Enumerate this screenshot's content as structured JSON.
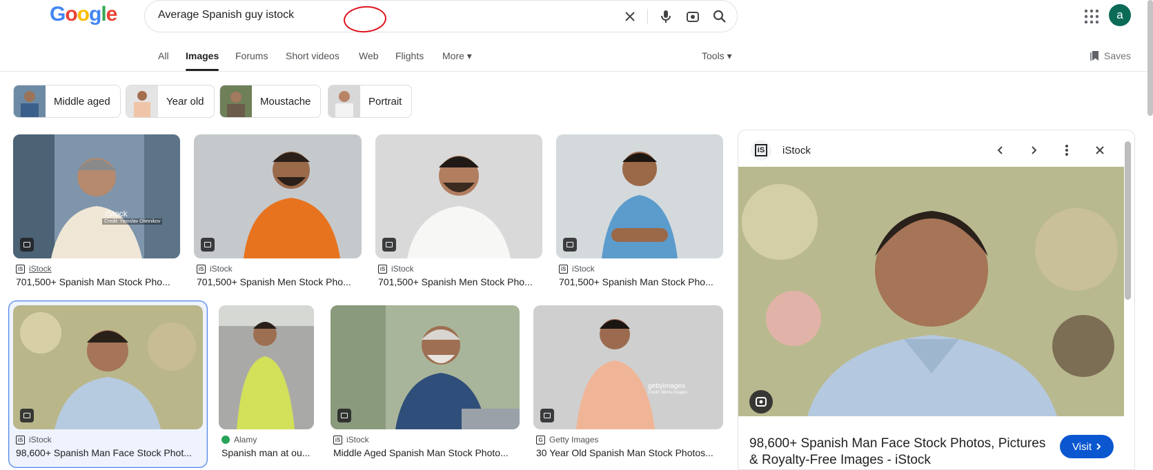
{
  "search": {
    "logo": "Google",
    "query": "Average Spanish guy istock"
  },
  "account": {
    "avatar_letter": "a"
  },
  "tabs": {
    "items": [
      "All",
      "Images",
      "Forums",
      "Short videos",
      "Web",
      "Flights",
      "More"
    ],
    "active": "Images",
    "tools_label": "Tools",
    "saves_label": "Saves"
  },
  "chips": [
    "Middle aged",
    "Year old",
    "Moustache",
    "Portrait"
  ],
  "results": [
    {
      "source": "iStock",
      "title": "701,500+ Spanish Man Stock Pho...",
      "watermark": "iStock",
      "credit": "Credit: Yaroslav Olieinikov"
    },
    {
      "source": "iStock",
      "title": "701,500+ Spanish Men Stock Pho..."
    },
    {
      "source": "iStock",
      "title": "701,500+ Spanish Men Stock Pho..."
    },
    {
      "source": "iStock",
      "title": "701,500+ Spanish Man Stock Pho..."
    },
    {
      "source": "iStock",
      "title": "98,600+ Spanish Man Face Stock Phot..."
    },
    {
      "source": "Alamy",
      "title": "Spanish man at ou..."
    },
    {
      "source": "iStock",
      "title": "Middle Aged Spanish Man Stock Photo..."
    },
    {
      "source": "Getty Images",
      "title": "30 Year Old Spanish Man Stock Photos...",
      "watermark": "gettyimages",
      "credit": "Credit: Morsa Images"
    }
  ],
  "preview": {
    "source": "iStock",
    "title": "98,600+ Spanish Man Face Stock Photos, Pictures & Royalty-Free Images - iStock",
    "visit_label": "Visit"
  },
  "colors": {
    "accent": "#0b57d0",
    "avatar": "#0b6b57",
    "annotation": "#e0121e"
  }
}
